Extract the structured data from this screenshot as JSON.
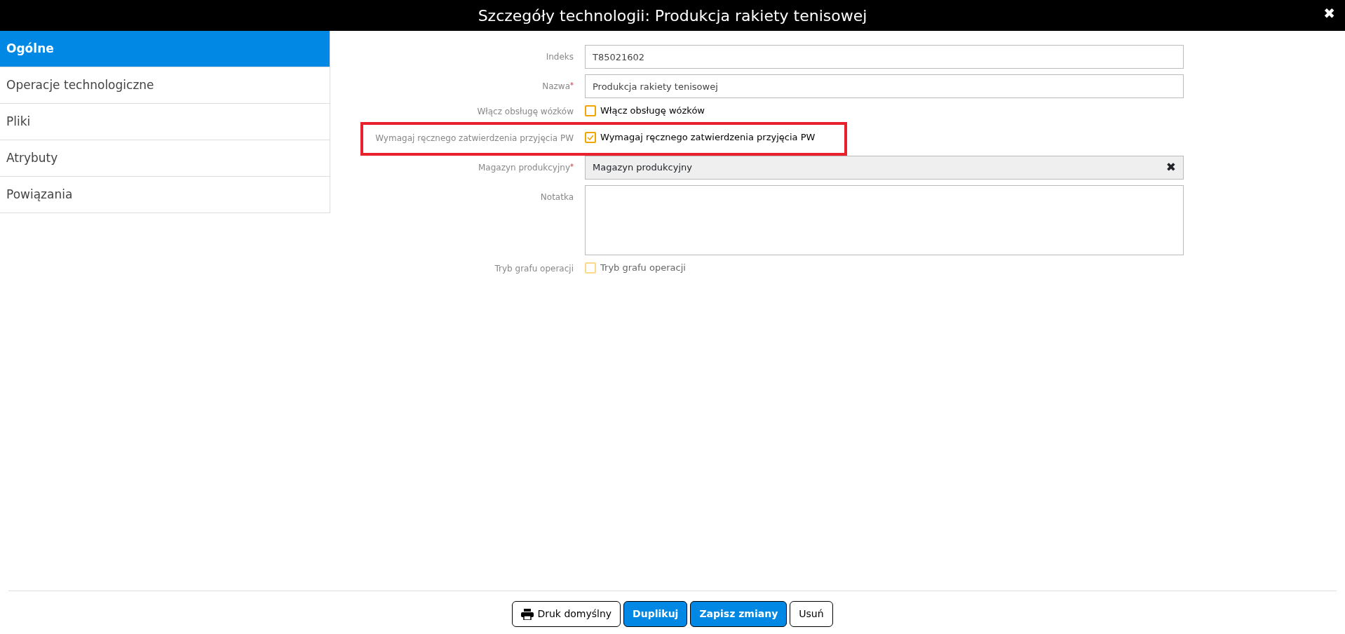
{
  "window": {
    "title": "Szczegóły technologii: Produkcja rakiety tenisowej",
    "close": "✖"
  },
  "sidebar": {
    "items": [
      {
        "label": "Ogólne",
        "selected": true
      },
      {
        "label": "Operacje technologiczne",
        "selected": false
      },
      {
        "label": "Pliki",
        "selected": false
      },
      {
        "label": "Atrybuty",
        "selected": false
      },
      {
        "label": "Powiązania",
        "selected": false
      }
    ]
  },
  "form": {
    "fields": [
      {
        "kind": "text",
        "label": "Indeks",
        "value": "T85021602",
        "highlighted": false
      },
      {
        "kind": "text",
        "label": "Nazwa",
        "required_mark": "*",
        "value": "Produkcja rakiety tenisowej",
        "highlighted": false
      },
      {
        "kind": "checkbox",
        "label": "Włącz obsługę wózków",
        "text": "Włącz obsługę wózków",
        "checked": false,
        "disabled": false,
        "highlighted": false
      },
      {
        "kind": "checkbox",
        "label": "Wymagaj ręcznego zatwierdzenia przyjęcia PW",
        "text": "Wymagaj ręcznego zatwierdzenia przyjęcia PW",
        "checked": true,
        "disabled": false,
        "highlighted": true
      },
      {
        "kind": "select",
        "label": "Magazyn produkcyjny",
        "required_mark": "*",
        "value": "Magazyn produkcyjny",
        "clear": "✖",
        "highlighted": false
      },
      {
        "kind": "textarea",
        "label": "Notatka",
        "highlighted": false
      },
      {
        "kind": "checkbox",
        "label": "Tryb grafu operacji",
        "text": "Tryb grafu operacji",
        "checked": false,
        "disabled": true,
        "highlighted": false
      }
    ]
  },
  "buttons": [
    {
      "kind": "print",
      "label": "Druk domyślny"
    },
    {
      "kind": "primary",
      "label": "Duplikuj"
    },
    {
      "kind": "primary",
      "label": "Zapisz zmiany"
    },
    {
      "kind": "outline",
      "label": "Usuń"
    }
  ]
}
